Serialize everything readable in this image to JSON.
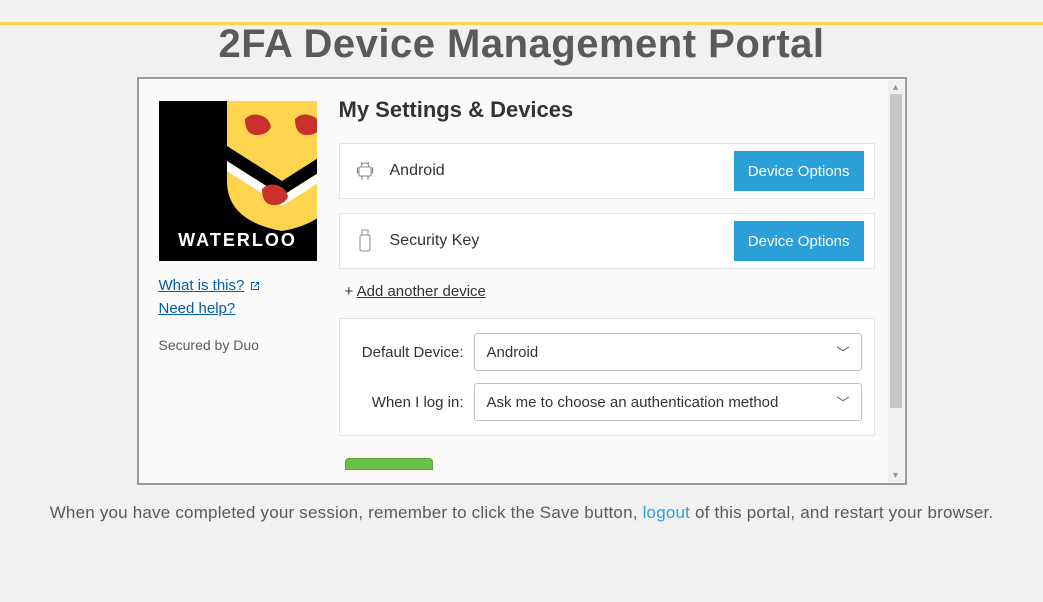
{
  "page_title": "2FA Device Management Portal",
  "logo_text": "WATERLOO",
  "sidebar": {
    "what_is_this": "What is this?",
    "need_help": "Need help?",
    "secured": "Secured by Duo"
  },
  "main": {
    "heading": "My Settings & Devices",
    "devices": [
      {
        "name": "Android",
        "icon": "android",
        "button": "Device Options"
      },
      {
        "name": "Security Key",
        "icon": "usb",
        "button": "Device Options"
      }
    ],
    "add_plus": "+",
    "add_link": "Add another device",
    "default_device_label": "Default Device:",
    "default_device_value": "Android",
    "when_login_label": "When I log in:",
    "when_login_value": "Ask me to choose an authentication method"
  },
  "footer": {
    "pre": "When you have completed your session, remember to click the Save button, ",
    "logout": "logout",
    "post": " of this portal, and restart your browser."
  }
}
